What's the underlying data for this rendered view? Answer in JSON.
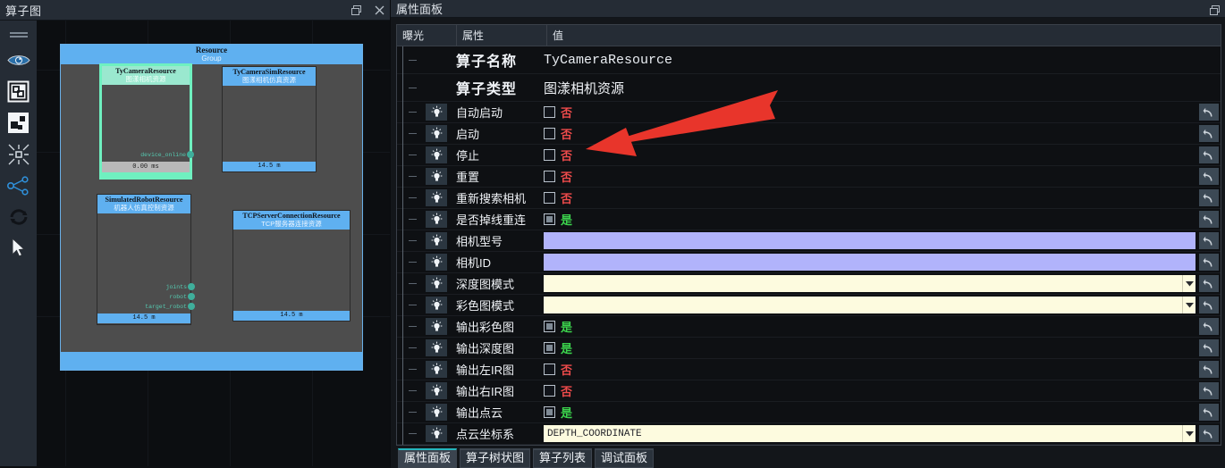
{
  "left_panel": {
    "title": "算子图",
    "undock_icon": "undock-icon",
    "close_icon": "close-icon",
    "tools": [
      {
        "name": "menu-grip",
        "label": "菜单"
      },
      {
        "name": "eye-icon",
        "label": "显示"
      },
      {
        "name": "frame-select-icon",
        "label": "框选"
      },
      {
        "name": "nodes-icon",
        "label": "节点"
      },
      {
        "name": "fit-view-icon",
        "label": "适应视图"
      },
      {
        "name": "share-graph-icon",
        "label": "连接"
      },
      {
        "name": "refresh-icon",
        "label": "刷新"
      },
      {
        "name": "cursor-icon",
        "label": "指针"
      }
    ],
    "group": {
      "title": "Resource",
      "subtitle": "Group"
    },
    "nodes": [
      {
        "title": "TyCameraResource",
        "subtitle": "图漾相机资源",
        "footer": "0.00 ms",
        "selected": true,
        "ports": [
          {
            "label": "device_online"
          }
        ]
      },
      {
        "title": "TyCameraSimResource",
        "subtitle": "图漾相机仿真资源",
        "footer": "14.5 m",
        "selected": false,
        "ports": []
      },
      {
        "title": "SimulatedRobotResource",
        "subtitle": "机器人仿真控制资源",
        "footer": "14.5 m",
        "selected": false,
        "ports": [
          {
            "label": "joints"
          },
          {
            "label": "robot"
          },
          {
            "label": "target_robot"
          }
        ]
      },
      {
        "title": "TCPServerConnectionResource",
        "subtitle": "TCP服务器连接资源",
        "footer": "14.5 m",
        "selected": false,
        "ports": []
      }
    ]
  },
  "right_panel": {
    "title": "属性面板",
    "columns": {
      "exposure": "曝光",
      "property": "属性",
      "value": "值"
    },
    "undo_icon": "undo-arrow-icon",
    "rows": [
      {
        "kind": "header",
        "property": "算子名称",
        "value": "TyCameraResource",
        "value_type": "mono",
        "undo": false
      },
      {
        "kind": "header",
        "property": "算子类型",
        "value": "图漾相机资源",
        "value_type": "cn",
        "undo": false
      },
      {
        "kind": "bool",
        "property": "自动启动",
        "checked": false,
        "value": "否",
        "undo": true
      },
      {
        "kind": "bool",
        "property": "启动",
        "checked": false,
        "value": "否",
        "undo": true
      },
      {
        "kind": "bool",
        "property": "停止",
        "checked": false,
        "value": "否",
        "undo": true
      },
      {
        "kind": "bool",
        "property": "重置",
        "checked": false,
        "value": "否",
        "undo": true
      },
      {
        "kind": "bool",
        "property": "重新搜索相机",
        "checked": false,
        "value": "否",
        "undo": true
      },
      {
        "kind": "bool",
        "property": "是否掉线重连",
        "checked": true,
        "value": "是",
        "undo": true
      },
      {
        "kind": "field",
        "property": "相机型号",
        "field": "purple",
        "value": "",
        "dropdown": false,
        "undo": true
      },
      {
        "kind": "field",
        "property": "相机ID",
        "field": "purple",
        "value": "",
        "dropdown": false,
        "undo": true
      },
      {
        "kind": "field",
        "property": "深度图模式",
        "field": "cream",
        "value": "",
        "dropdown": true,
        "undo": true
      },
      {
        "kind": "field",
        "property": "彩色图模式",
        "field": "cream",
        "value": "",
        "dropdown": true,
        "undo": true
      },
      {
        "kind": "bool",
        "property": "输出彩色图",
        "checked": true,
        "value": "是",
        "undo": true
      },
      {
        "kind": "bool",
        "property": "输出深度图",
        "checked": true,
        "value": "是",
        "undo": true
      },
      {
        "kind": "bool",
        "property": "输出左IR图",
        "checked": false,
        "value": "否",
        "undo": true
      },
      {
        "kind": "bool",
        "property": "输出右IR图",
        "checked": false,
        "value": "否",
        "undo": true
      },
      {
        "kind": "bool",
        "property": "输出点云",
        "checked": true,
        "value": "是",
        "undo": true
      },
      {
        "kind": "field",
        "property": "点云坐标系",
        "field": "cream",
        "value": "DEPTH_COORDINATE",
        "dropdown": true,
        "undo": true
      }
    ]
  },
  "tabs": [
    {
      "label": "属性面板",
      "active": true
    },
    {
      "label": "算子树状图",
      "active": false
    },
    {
      "label": "算子列表",
      "active": false
    },
    {
      "label": "调试面板",
      "active": false
    }
  ],
  "annotation": {
    "name": "red-arrow-annotation",
    "color": "#e8352b"
  }
}
